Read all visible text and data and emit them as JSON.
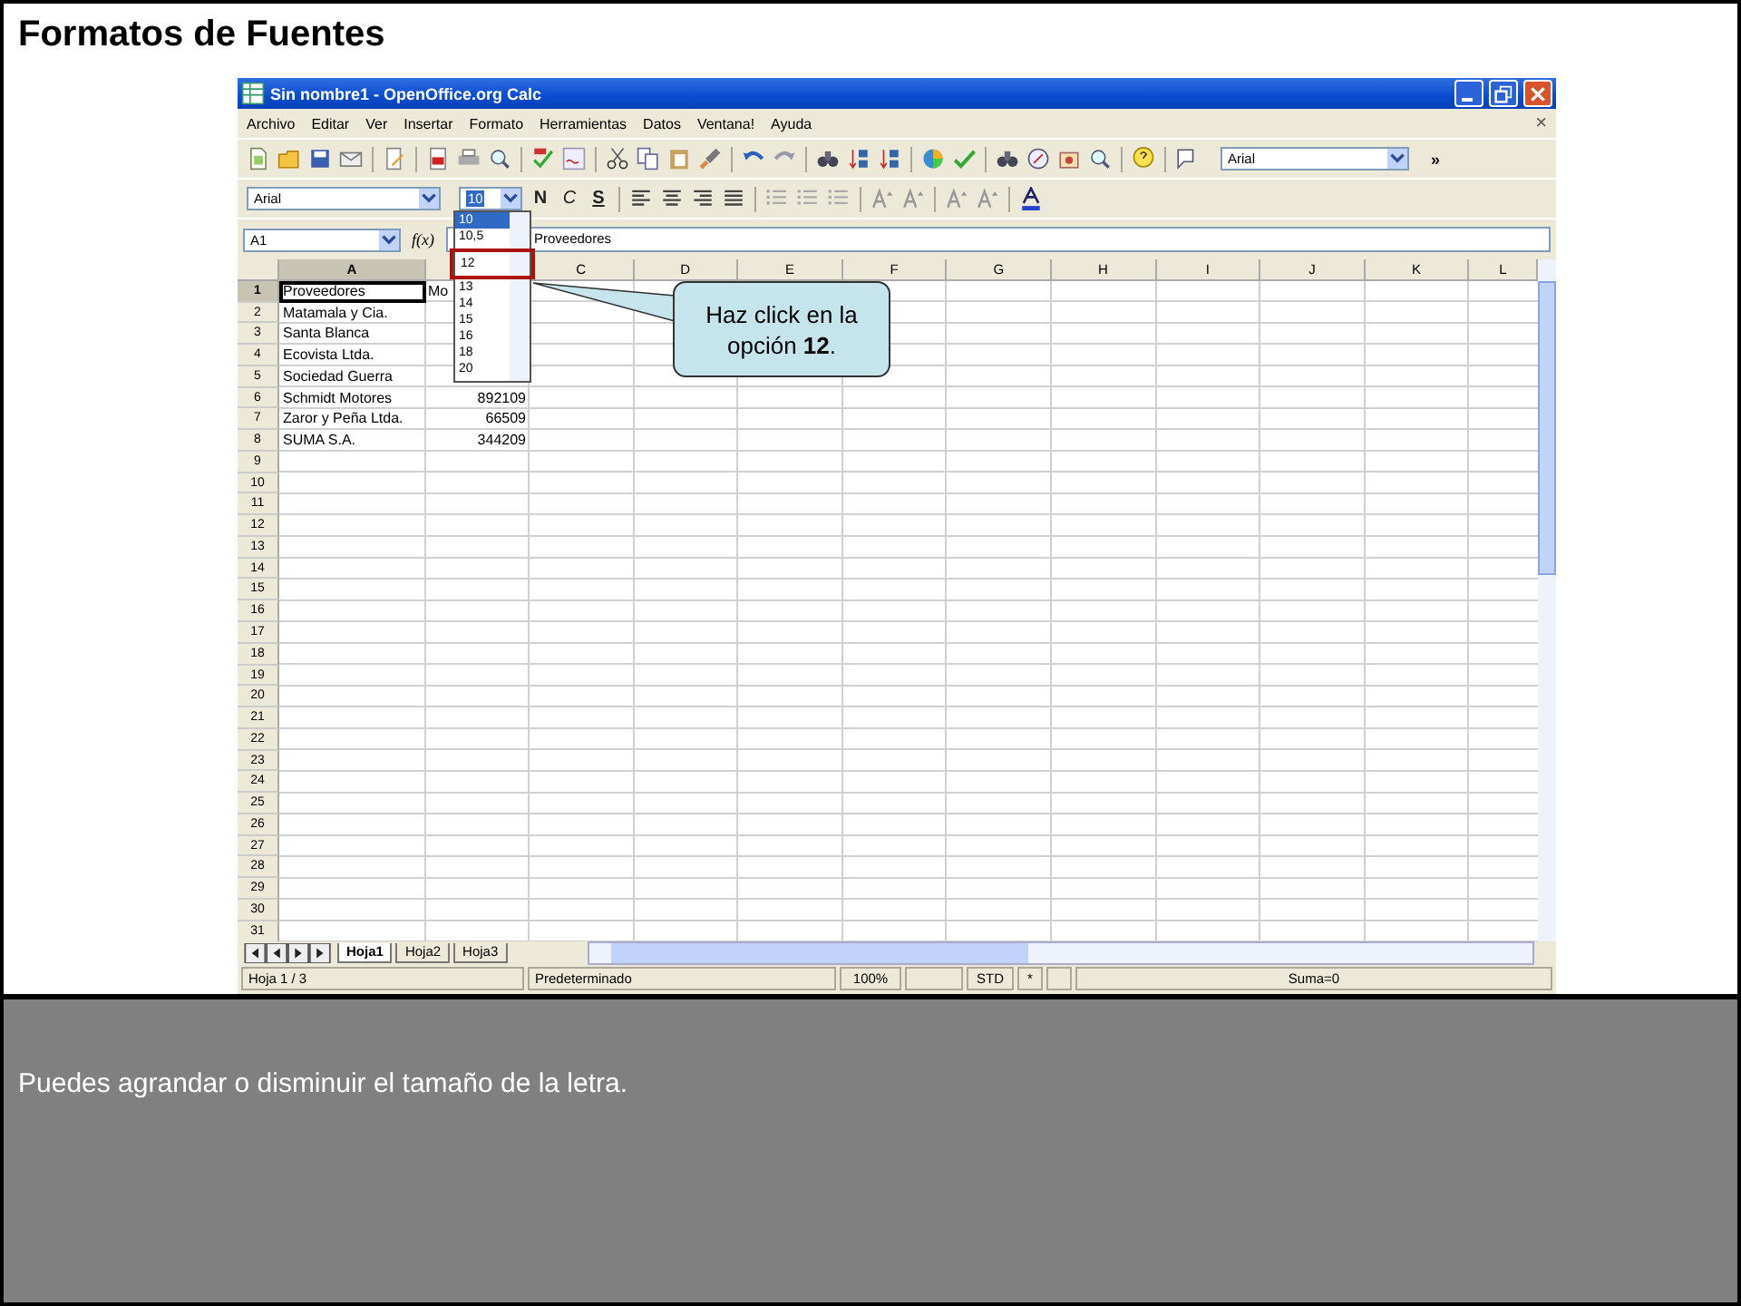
{
  "slide": {
    "title": "Formatos de Fuentes",
    "caption": "Puedes agrandar o disminuir el tamaño de la letra."
  },
  "window": {
    "title": "Sin nombre1 - OpenOffice.org Calc"
  },
  "menu": [
    "Archivo",
    "Editar",
    "Ver",
    "Insertar",
    "Formato",
    "Herramientas",
    "Datos",
    "Ventana!",
    "Ayuda"
  ],
  "document_close": "×",
  "toolbar": {
    "font_name": "Arial",
    "overflow": "»"
  },
  "formatting": {
    "font_name": "Arial",
    "font_size": "10",
    "buttons": [
      {
        "label": "N",
        "kind": "bold"
      },
      {
        "label": "C",
        "kind": "italic"
      },
      {
        "label": "S",
        "kind": "underline"
      }
    ]
  },
  "size_list": [
    {
      "label": "10",
      "selected": true,
      "highlighted": false
    },
    {
      "label": "10,5",
      "selected": false,
      "highlighted": false
    },
    {
      "label": "12",
      "selected": false,
      "highlighted": true
    },
    {
      "label": "13",
      "selected": false,
      "highlighted": false
    },
    {
      "label": "14",
      "selected": false,
      "highlighted": false
    },
    {
      "label": "15",
      "selected": false,
      "highlighted": false
    },
    {
      "label": "16",
      "selected": false,
      "highlighted": false
    },
    {
      "label": "18",
      "selected": false,
      "highlighted": false
    },
    {
      "label": "20",
      "selected": false,
      "highlighted": false
    }
  ],
  "formula_bar": {
    "cell": "A1",
    "wizard": "f(x)",
    "content": "Proveedores"
  },
  "columns": [
    {
      "label": "A"
    },
    {},
    {
      "label": "C"
    },
    {
      "label": "D"
    },
    {
      "label": "E"
    },
    {
      "label": "F"
    },
    {
      "label": "G"
    },
    {
      "label": "H"
    },
    {
      "label": "I"
    },
    {
      "label": "J"
    },
    {
      "label": "K"
    },
    {
      "label": "L"
    }
  ],
  "rows": [
    {
      "number": "1",
      "active": true,
      "cells": [
        "Proveedores",
        "Mo"
      ]
    },
    {
      "number": "2",
      "active": false,
      "cells": [
        "Matamala y Cia.",
        ""
      ]
    },
    {
      "number": "3",
      "active": false,
      "cells": [
        "Santa Blanca",
        ""
      ]
    },
    {
      "number": "4",
      "active": false,
      "cells": [
        "Ecovista Ltda.",
        ""
      ]
    },
    {
      "number": "5",
      "active": false,
      "cells": [
        "Sociedad Guerra",
        ""
      ]
    },
    {
      "number": "6",
      "active": false,
      "cells": [
        "Schmidt Motores",
        "892109"
      ]
    },
    {
      "number": "7",
      "active": false,
      "cells": [
        "Zaror y Peña Ltda.",
        "66509"
      ]
    },
    {
      "number": "8",
      "active": false,
      "cells": [
        "SUMA S.A.",
        "344209"
      ]
    },
    {
      "number": "9",
      "active": false
    },
    {
      "number": "10",
      "active": false
    },
    {
      "number": "11",
      "active": false
    },
    {
      "number": "12",
      "active": false
    },
    {
      "number": "13",
      "active": false
    },
    {
      "number": "14",
      "active": false
    },
    {
      "number": "15",
      "active": false
    },
    {
      "number": "16",
      "active": false
    },
    {
      "number": "17",
      "active": false
    },
    {
      "number": "18",
      "active": false
    },
    {
      "number": "19",
      "active": false
    },
    {
      "number": "20",
      "active": false
    },
    {
      "number": "21",
      "active": false
    },
    {
      "number": "22",
      "active": false
    },
    {
      "number": "23",
      "active": false
    },
    {
      "number": "24",
      "active": false
    },
    {
      "number": "25",
      "active": false
    },
    {
      "number": "26",
      "active": false
    },
    {
      "number": "27",
      "active": false
    },
    {
      "number": "28",
      "active": false
    },
    {
      "number": "29",
      "active": false
    },
    {
      "number": "30",
      "active": false
    },
    {
      "number": "31",
      "active": false
    }
  ],
  "sheet_tabs": [
    {
      "label": "Hoja1",
      "selected": true
    },
    {
      "label": "Hoja2",
      "selected": false
    },
    {
      "label": "Hoja3",
      "selected": false
    }
  ],
  "status_bar": [
    {
      "kind": "text",
      "text": "Hoja 1 / 3"
    },
    {
      "kind": "text",
      "text": "Predeterminado"
    },
    {
      "kind": "text",
      "text": "100%"
    },
    {
      "kind": "blank"
    },
    {
      "kind": "text",
      "text": "STD"
    },
    {
      "kind": "text",
      "text": "*"
    },
    {
      "kind": "blank"
    },
    {
      "kind": "text",
      "text": "Suma=0"
    }
  ],
  "callout": {
    "text": "Haz click en la opción **12**."
  }
}
